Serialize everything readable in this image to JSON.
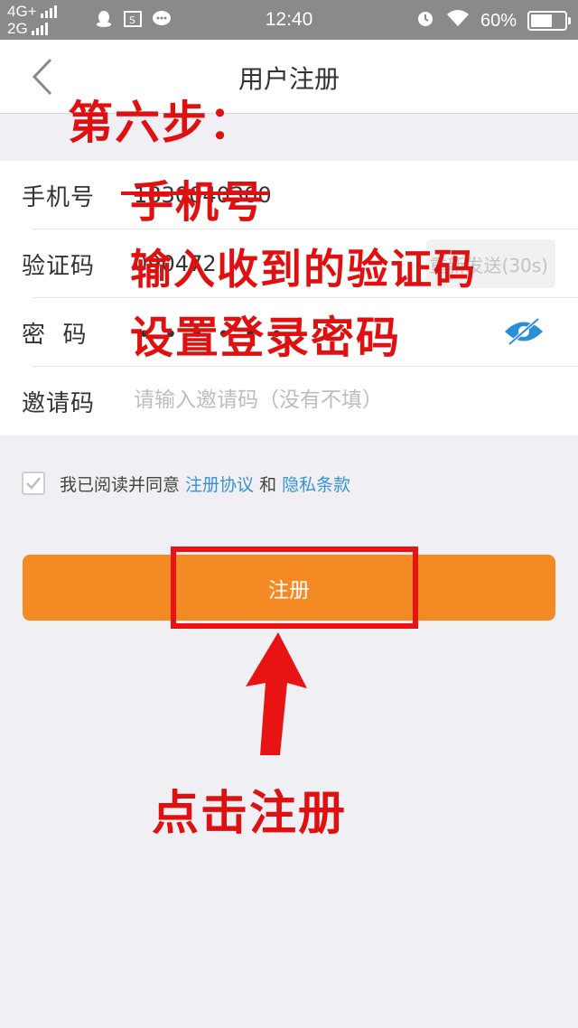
{
  "status_bar": {
    "net_top": "4G+",
    "net_bottom": "2G",
    "time": "12:40",
    "battery": "60%",
    "icons": [
      "qq-icon",
      "image-icon",
      "chat-icon",
      "alarm-icon",
      "wifi-icon",
      "battery-icon"
    ]
  },
  "nav": {
    "title": "用户注册",
    "back_icon": "chevron-left-icon"
  },
  "form": {
    "phone": {
      "label": "手机号",
      "value": "1830040300"
    },
    "code": {
      "label": "验证码",
      "value": "090472",
      "resend_label": "重新发送(30s)"
    },
    "password": {
      "label": "密  码",
      "masked": "••••••",
      "toggle_icon": "eye-hidden-icon"
    },
    "invite": {
      "label": "邀请码",
      "placeholder": "请输入邀请码（没有不填）"
    }
  },
  "agreement": {
    "prefix": "我已阅读并同意 ",
    "terms_link": "注册协议",
    "and": " 和 ",
    "privacy_link": "隐私条款",
    "checked": true
  },
  "register_button": {
    "label": "注册"
  },
  "annotations": {
    "step": "第六步：",
    "phone": "手机号",
    "code": "输入收到的验证码",
    "password": "设置登录密码",
    "click": "点击注册",
    "color": "#e01010"
  },
  "colors": {
    "accent": "#f48a24",
    "link": "#3a92d6",
    "background": "#efeff4",
    "status_bar": "#8a8a8a"
  }
}
